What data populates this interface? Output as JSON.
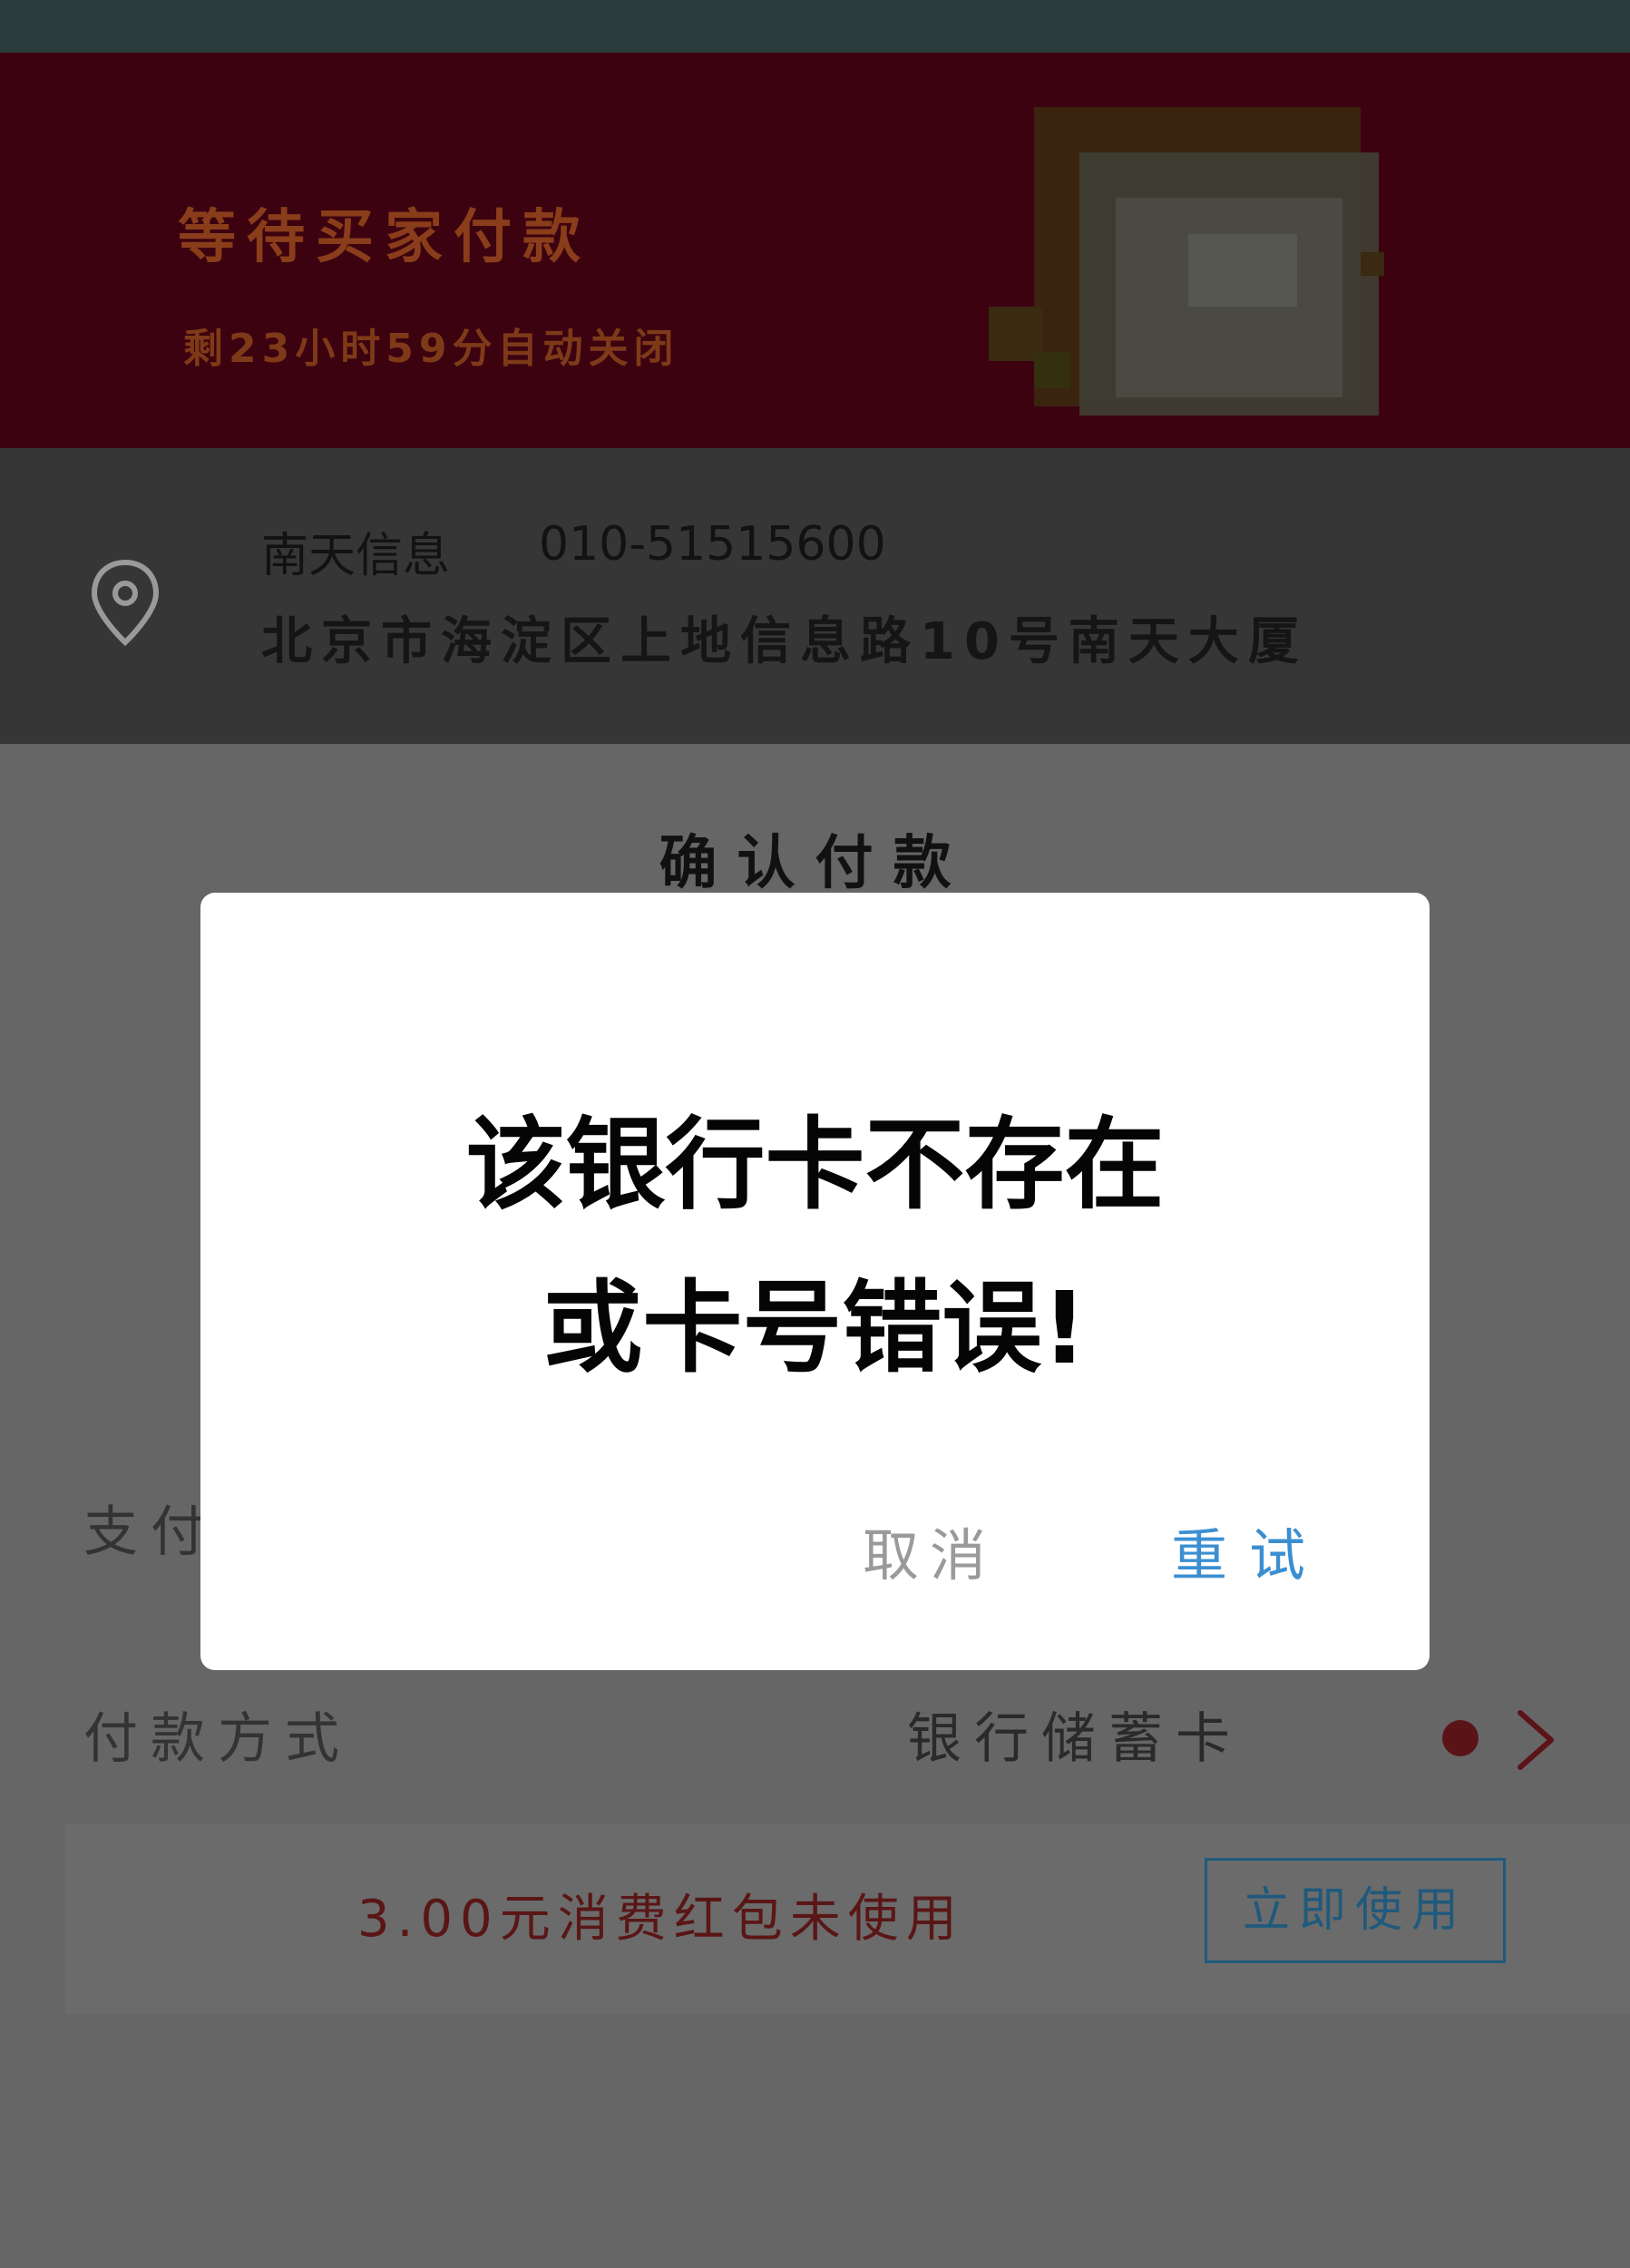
{
  "banner": {
    "title": "等待买家付款",
    "subtitle": "剩23小时59分自动关闭"
  },
  "address": {
    "name": "南天信息",
    "phone": "010-51515600",
    "line": "北京市海淀区上地信息路10号南天大厦"
  },
  "payment": {
    "title": "确认付款",
    "partial_row_label": "支付",
    "method_label": "付款方式",
    "method_value": "银行储蓄卡"
  },
  "coupon": {
    "text": "3.00元消费红包未使用",
    "button_label": "立即使用"
  },
  "dialog": {
    "message_line1": "该银行卡不存在",
    "message_line2": "或卡号错误!",
    "cancel_label": "取消",
    "retry_label": "重试"
  },
  "colors": {
    "banner_bg": "#3c0210",
    "overlay_bg": "#666666",
    "accent_blue": "#3b8fd1",
    "dot_red": "#5a1418"
  },
  "icons": {
    "location": "location-pin-icon",
    "chevron": "chevron-right-icon"
  }
}
